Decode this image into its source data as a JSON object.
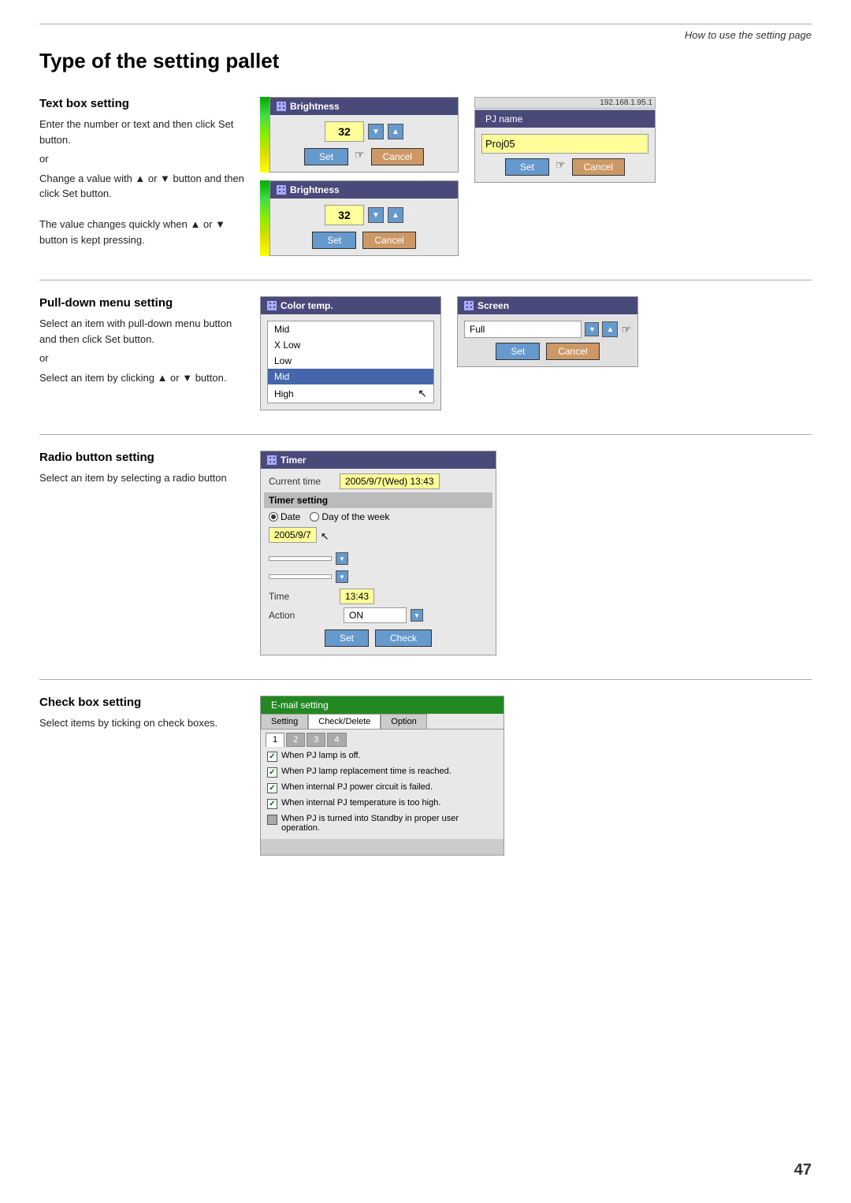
{
  "page": {
    "subtitle": "How to use the setting page",
    "title": "Type of the setting pallet",
    "page_number": "47"
  },
  "sections": {
    "text_box": {
      "title": "Text box setting",
      "desc_1": "Enter the number or text and then click Set button.",
      "or_1": "or",
      "desc_2": "Change a value with ▲ or ▼ button and then click Set button.",
      "desc_3": "The value changes quickly when ▲ or ▼ button is kept pressing.",
      "brightness_value": "32",
      "set_label": "Set",
      "cancel_label": "Cancel",
      "widget_title": "Brightness",
      "pjname_title": "PJ name",
      "pjname_value": "Proj05",
      "top_info": "192.168.1.95.1"
    },
    "pulldown": {
      "title": "Pull-down menu setting",
      "desc_1": "Select an item with pull-down menu button and then click Set button.",
      "or_1": "or",
      "desc_2": "Select an item by clicking ▲ or ▼ button.",
      "colortemp_title": "Color temp.",
      "colortemp_items": [
        "Mid",
        "X Low",
        "Low",
        "Mid",
        "High"
      ],
      "colortemp_selected": "Mid",
      "screen_title": "Screen",
      "screen_value": "Full",
      "set_label": "Set",
      "cancel_label": "Cancel"
    },
    "radio": {
      "title": "Radio button setting",
      "desc": "Select an item by selecting a radio button",
      "timer_title": "Timer",
      "current_time_label": "Current time",
      "current_time_value": "2005/9/7(Wed) 13:43",
      "timer_setting_label": "Timer setting",
      "date_label": "Date",
      "day_of_week_label": "Day of the week",
      "date_value": "2005/9/7",
      "time_label": "Time",
      "time_value": "13:43",
      "action_label": "Action",
      "action_value": "ON",
      "set_label": "Set",
      "check_label": "Check"
    },
    "checkbox": {
      "title": "Check box setting",
      "desc": "Select items by ticking on check boxes.",
      "email_title": "E-mail setting",
      "tabs": [
        "Setting",
        "Check/Delete",
        "Option"
      ],
      "active_tab": "Check/Delete",
      "subtabs": [
        "1",
        "2",
        "3",
        "4"
      ],
      "active_subtab": "1",
      "items": [
        {
          "text": "When PJ lamp is off.",
          "checked": true
        },
        {
          "text": "When PJ lamp replacement time is reached.",
          "checked": true
        },
        {
          "text": "When internal PJ power circuit is failed.",
          "checked": true
        },
        {
          "text": "When internal PJ temperature is too high.",
          "checked": true
        },
        {
          "text": "When PJ is turned into Standby in proper user operation.",
          "checked": false
        }
      ]
    }
  }
}
